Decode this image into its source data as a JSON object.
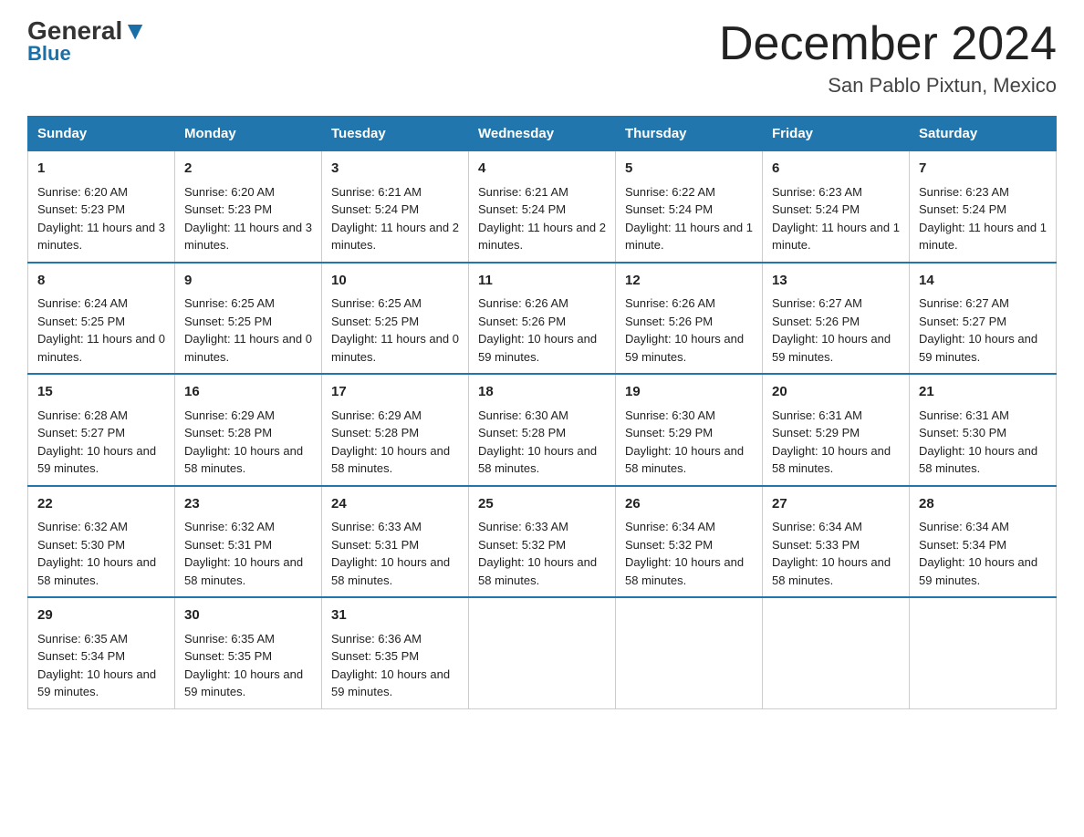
{
  "logo": {
    "general_text": "General",
    "blue_text": "Blue"
  },
  "title": "December 2024",
  "subtitle": "San Pablo Pixtun, Mexico",
  "days": [
    "Sunday",
    "Monday",
    "Tuesday",
    "Wednesday",
    "Thursday",
    "Friday",
    "Saturday"
  ],
  "weeks": [
    [
      {
        "day": "1",
        "sunrise": "6:20 AM",
        "sunset": "5:23 PM",
        "daylight": "11 hours and 3 minutes."
      },
      {
        "day": "2",
        "sunrise": "6:20 AM",
        "sunset": "5:23 PM",
        "daylight": "11 hours and 3 minutes."
      },
      {
        "day": "3",
        "sunrise": "6:21 AM",
        "sunset": "5:24 PM",
        "daylight": "11 hours and 2 minutes."
      },
      {
        "day": "4",
        "sunrise": "6:21 AM",
        "sunset": "5:24 PM",
        "daylight": "11 hours and 2 minutes."
      },
      {
        "day": "5",
        "sunrise": "6:22 AM",
        "sunset": "5:24 PM",
        "daylight": "11 hours and 1 minute."
      },
      {
        "day": "6",
        "sunrise": "6:23 AM",
        "sunset": "5:24 PM",
        "daylight": "11 hours and 1 minute."
      },
      {
        "day": "7",
        "sunrise": "6:23 AM",
        "sunset": "5:24 PM",
        "daylight": "11 hours and 1 minute."
      }
    ],
    [
      {
        "day": "8",
        "sunrise": "6:24 AM",
        "sunset": "5:25 PM",
        "daylight": "11 hours and 0 minutes."
      },
      {
        "day": "9",
        "sunrise": "6:25 AM",
        "sunset": "5:25 PM",
        "daylight": "11 hours and 0 minutes."
      },
      {
        "day": "10",
        "sunrise": "6:25 AM",
        "sunset": "5:25 PM",
        "daylight": "11 hours and 0 minutes."
      },
      {
        "day": "11",
        "sunrise": "6:26 AM",
        "sunset": "5:26 PM",
        "daylight": "10 hours and 59 minutes."
      },
      {
        "day": "12",
        "sunrise": "6:26 AM",
        "sunset": "5:26 PM",
        "daylight": "10 hours and 59 minutes."
      },
      {
        "day": "13",
        "sunrise": "6:27 AM",
        "sunset": "5:26 PM",
        "daylight": "10 hours and 59 minutes."
      },
      {
        "day": "14",
        "sunrise": "6:27 AM",
        "sunset": "5:27 PM",
        "daylight": "10 hours and 59 minutes."
      }
    ],
    [
      {
        "day": "15",
        "sunrise": "6:28 AM",
        "sunset": "5:27 PM",
        "daylight": "10 hours and 59 minutes."
      },
      {
        "day": "16",
        "sunrise": "6:29 AM",
        "sunset": "5:28 PM",
        "daylight": "10 hours and 58 minutes."
      },
      {
        "day": "17",
        "sunrise": "6:29 AM",
        "sunset": "5:28 PM",
        "daylight": "10 hours and 58 minutes."
      },
      {
        "day": "18",
        "sunrise": "6:30 AM",
        "sunset": "5:28 PM",
        "daylight": "10 hours and 58 minutes."
      },
      {
        "day": "19",
        "sunrise": "6:30 AM",
        "sunset": "5:29 PM",
        "daylight": "10 hours and 58 minutes."
      },
      {
        "day": "20",
        "sunrise": "6:31 AM",
        "sunset": "5:29 PM",
        "daylight": "10 hours and 58 minutes."
      },
      {
        "day": "21",
        "sunrise": "6:31 AM",
        "sunset": "5:30 PM",
        "daylight": "10 hours and 58 minutes."
      }
    ],
    [
      {
        "day": "22",
        "sunrise": "6:32 AM",
        "sunset": "5:30 PM",
        "daylight": "10 hours and 58 minutes."
      },
      {
        "day": "23",
        "sunrise": "6:32 AM",
        "sunset": "5:31 PM",
        "daylight": "10 hours and 58 minutes."
      },
      {
        "day": "24",
        "sunrise": "6:33 AM",
        "sunset": "5:31 PM",
        "daylight": "10 hours and 58 minutes."
      },
      {
        "day": "25",
        "sunrise": "6:33 AM",
        "sunset": "5:32 PM",
        "daylight": "10 hours and 58 minutes."
      },
      {
        "day": "26",
        "sunrise": "6:34 AM",
        "sunset": "5:32 PM",
        "daylight": "10 hours and 58 minutes."
      },
      {
        "day": "27",
        "sunrise": "6:34 AM",
        "sunset": "5:33 PM",
        "daylight": "10 hours and 58 minutes."
      },
      {
        "day": "28",
        "sunrise": "6:34 AM",
        "sunset": "5:34 PM",
        "daylight": "10 hours and 59 minutes."
      }
    ],
    [
      {
        "day": "29",
        "sunrise": "6:35 AM",
        "sunset": "5:34 PM",
        "daylight": "10 hours and 59 minutes."
      },
      {
        "day": "30",
        "sunrise": "6:35 AM",
        "sunset": "5:35 PM",
        "daylight": "10 hours and 59 minutes."
      },
      {
        "day": "31",
        "sunrise": "6:36 AM",
        "sunset": "5:35 PM",
        "daylight": "10 hours and 59 minutes."
      },
      null,
      null,
      null,
      null
    ]
  ],
  "labels": {
    "sunrise": "Sunrise:",
    "sunset": "Sunset:",
    "daylight": "Daylight:"
  }
}
